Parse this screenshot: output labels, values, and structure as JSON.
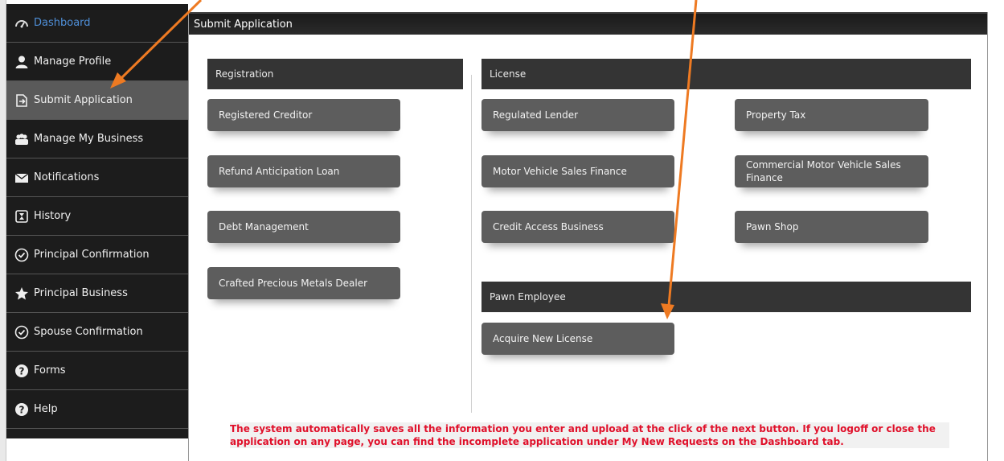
{
  "sidebar": {
    "items": [
      {
        "label": "Dashboard",
        "icon": "dashboard-icon"
      },
      {
        "label": "Manage Profile",
        "icon": "user-icon"
      },
      {
        "label": "Submit Application",
        "icon": "submit-icon"
      },
      {
        "label": "Manage My Business",
        "icon": "people-icon"
      },
      {
        "label": "Notifications",
        "icon": "envelope-icon"
      },
      {
        "label": "History",
        "icon": "history-icon"
      },
      {
        "label": "Principal Confirmation",
        "icon": "check-circle-icon"
      },
      {
        "label": "Principal Business",
        "icon": "star-icon"
      },
      {
        "label": "Spouse Confirmation",
        "icon": "check-circle-icon"
      },
      {
        "label": "Forms",
        "icon": "question-icon"
      },
      {
        "label": "Help",
        "icon": "question-icon"
      }
    ]
  },
  "main": {
    "title": "Submit Application",
    "registration": {
      "header": "Registration",
      "tiles": [
        "Registered Creditor",
        "Refund Anticipation Loan",
        "Debt Management",
        "Crafted Precious Metals Dealer"
      ]
    },
    "license": {
      "header": "License",
      "tiles": [
        "Regulated Lender",
        "Property Tax",
        "Motor Vehicle Sales Finance",
        "Commercial Motor Vehicle Sales Finance",
        "Credit Access Business",
        "Pawn Shop"
      ]
    },
    "pawn_employee": {
      "header": "Pawn Employee",
      "tiles": [
        "Acquire New License"
      ]
    },
    "notice": "The system automatically saves all the information you enter and upload at the click of the next button. If you logoff or close the application on any page, you can find the incomplete application under My New Requests on the Dashboard tab."
  },
  "colors": {
    "annotation_arrow": "#ee7a22",
    "notice_text": "#e0102a",
    "dashboard_link": "#4f8fd8"
  }
}
